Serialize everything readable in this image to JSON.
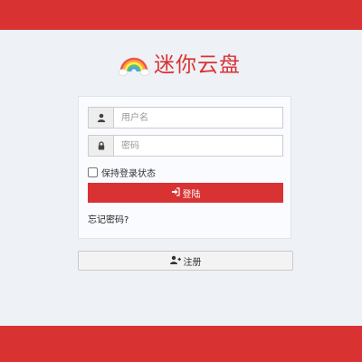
{
  "app": {
    "title": "迷你云盘",
    "logo_icon": "rainbow-cloud-icon"
  },
  "colors": {
    "accent": "#d93233",
    "background": "#eef1f6"
  },
  "login_form": {
    "username_placeholder": "用户名",
    "username_icon": "user-icon",
    "password_placeholder": "密码",
    "password_icon": "lock-icon",
    "remember_label": "保持登录状态",
    "remember_checked": false,
    "login_label": "登陆",
    "login_icon": "sign-in-icon",
    "forgot_label": "忘记密码?"
  },
  "register": {
    "label": "注册",
    "icon": "user-plus-icon"
  }
}
